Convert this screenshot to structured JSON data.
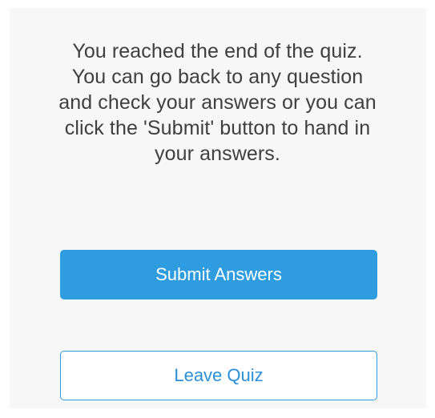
{
  "end_of_quiz": {
    "message_lines": [
      "You reached the end of the quiz.",
      "You can go back to any question",
      "and check your answers or you can",
      "click the 'Submit'  button to hand in",
      "your answers."
    ],
    "submit_label": "Submit Answers",
    "leave_label": "Leave Quiz"
  },
  "colors": {
    "primary": "#2e9cdf",
    "text": "#3f3f3f",
    "background": "#f7f7f7"
  }
}
